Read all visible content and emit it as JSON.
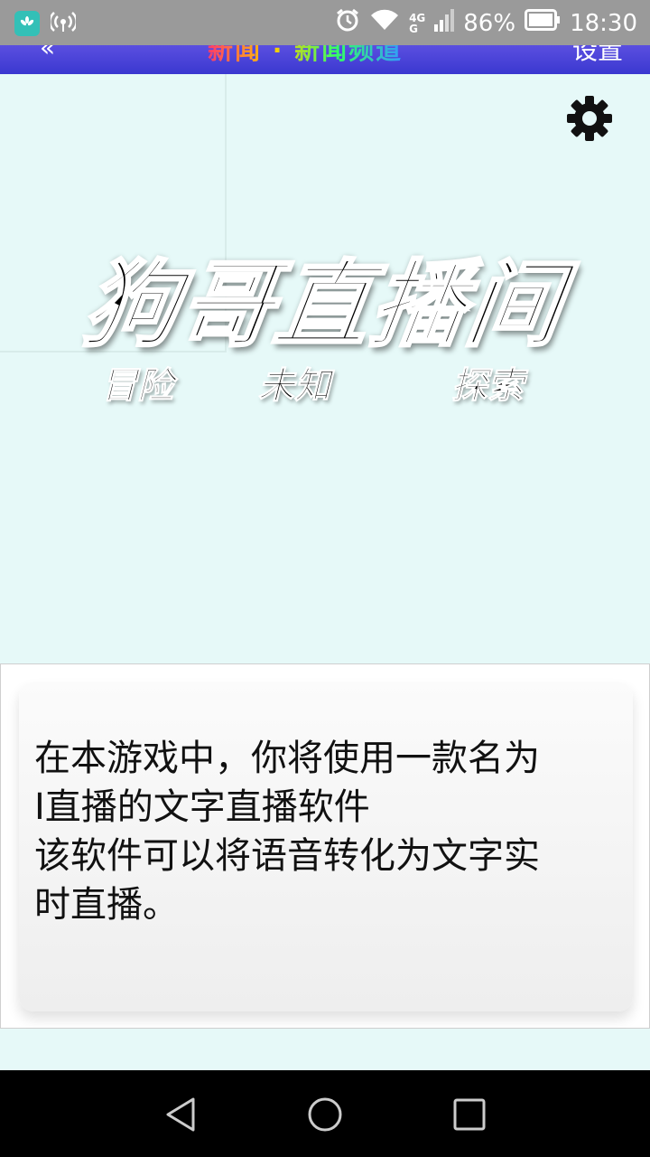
{
  "status_bar": {
    "network_type_top": "4G",
    "network_type_bottom": "G",
    "battery": "86%",
    "time": "18:30",
    "icons": [
      "huawei-app-icon",
      "hotspot-icon",
      "alarm-icon",
      "wifi-icon",
      "signal-icon",
      "battery-icon"
    ]
  },
  "header": {
    "back_glyph": "«",
    "title": "新闻 · 新闻频道",
    "right_label": "设置"
  },
  "logo": {
    "title": "狗哥直播间",
    "tags": [
      "冒险",
      "未知",
      "探索"
    ]
  },
  "dialog": {
    "lines": [
      "在本游戏中，你将使用一款名为",
      "I直播的文字直播软件",
      "该软件可以将语音转化为文字实",
      "时直播。"
    ]
  },
  "nav": {
    "buttons": [
      "back-icon",
      "home-icon",
      "recents-icon"
    ]
  },
  "colors": {
    "background": "#e6f9f8",
    "header": "#3a38d0",
    "status_bar": "#9a9a9a",
    "app_icon": "#33c0b7"
  }
}
